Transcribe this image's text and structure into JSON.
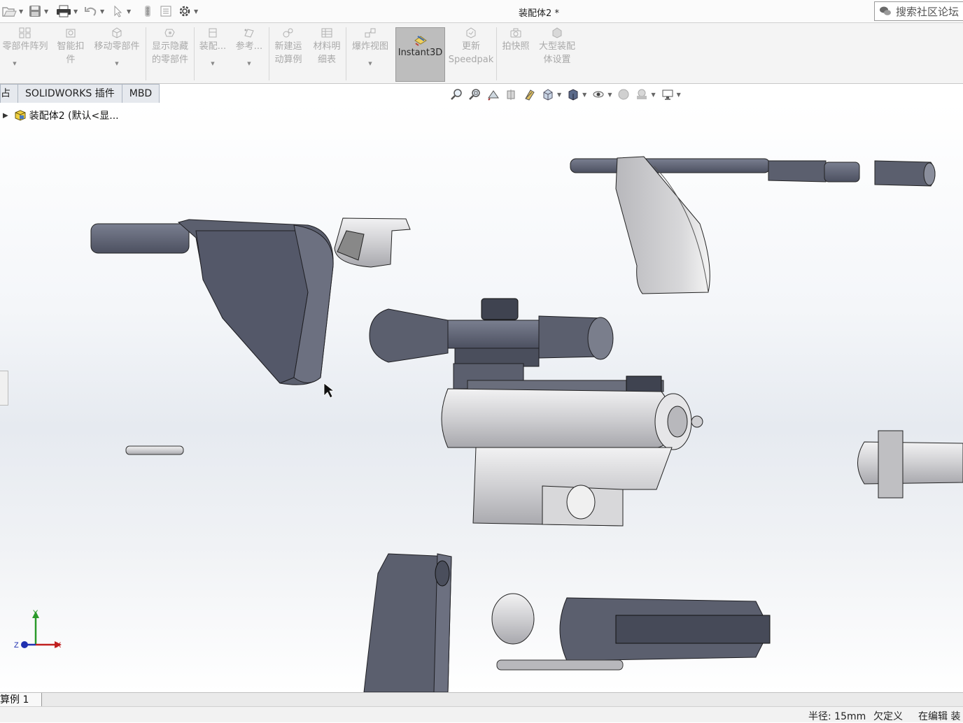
{
  "titlebar": {
    "document_title": "装配体2 *",
    "search_placeholder": "搜索社区论坛"
  },
  "ribbon": {
    "buttons": [
      {
        "label1": "零部件阵列",
        "label2": "",
        "dropdown": true
      },
      {
        "label1": "智能扣",
        "label2": "件"
      },
      {
        "label1": "移动零部件",
        "label2": "",
        "dropdown": true
      },
      {
        "label1": "显示隐藏",
        "label2": "的零部件"
      },
      {
        "label1": "装配...",
        "label2": "",
        "dropdown": true
      },
      {
        "label1": "参考...",
        "label2": "",
        "dropdown": true
      },
      {
        "label1": "新建运",
        "label2": "动算例"
      },
      {
        "label1": "材料明",
        "label2": "细表"
      },
      {
        "label1": "爆炸视图",
        "label2": "",
        "dropdown": true
      },
      {
        "label1": "Instant3D",
        "label2": ""
      },
      {
        "label1": "更新",
        "label2": "Speedpak"
      },
      {
        "label1": "拍快照",
        "label2": ""
      },
      {
        "label1": "大型装配",
        "label2": "体设置"
      }
    ]
  },
  "tabs": [
    {
      "label": "占"
    },
    {
      "label": "SOLIDWORKS 插件"
    },
    {
      "label": "MBD"
    }
  ],
  "tree": {
    "root_label": "装配体2 (默认<显..."
  },
  "triad": {
    "x": "X",
    "y": "Y",
    "z": "Z"
  },
  "bottom_tabs": [
    {
      "label": "算例 1"
    }
  ],
  "status": {
    "radius": "半径: 15mm",
    "definition": "欠定义",
    "editing": "在编辑 装"
  },
  "colors": {
    "part_dark": "#5b5f6e",
    "part_light": "#cfcfd2",
    "instant3d_bg": "#bdbdbd",
    "ribbon_text_disabled": "#a9a9a9"
  }
}
